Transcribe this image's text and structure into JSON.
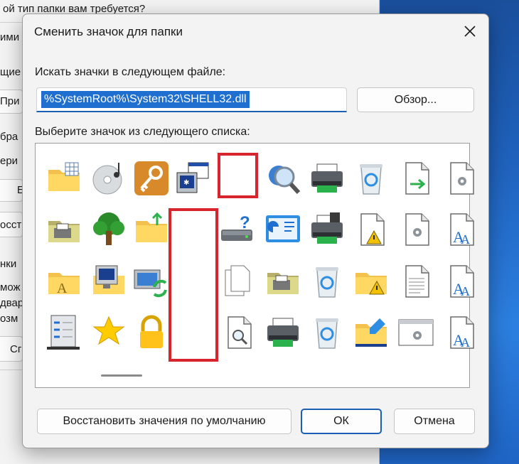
{
  "background_window": {
    "fragments": [
      "ой тип папки вам требуется?",
      "ими",
      "щие",
      "При",
      "бра",
      "ери",
      "Е",
      "осст",
      "нки",
      "мож",
      "двар",
      "озм",
      "Сг"
    ]
  },
  "dialog": {
    "title": "Сменить значок для папки",
    "close_glyph": "✕",
    "file_label": "Искать значки в следующем файле:",
    "file_value": "%SystemRoot%\\System32\\SHELL32.dll",
    "browse_label": "Обзор...",
    "list_label": "Выберите значок из следующего списка:",
    "icons": [
      [
        "folder-grid-icon",
        "cd-music-icon",
        "key-icon",
        "computer-window-icon",
        "blank",
        "magnifier-globe-icon",
        "printer-icon",
        "recycle-bin-icon",
        "file-arrow-icon",
        "gear-file-icon"
      ],
      [
        "printer-folder-icon",
        "tree-icon",
        "folder-up-icon",
        "blank",
        "drive-question-icon",
        "control-panel-icon",
        "printer-fax-icon",
        "file-warning-icon",
        "gear-file-icon",
        "font-file-icon"
      ],
      [
        "font-folder-icon",
        "computer-folder-icon",
        "monitor-sync-icon",
        "blank",
        "copy-files-icon",
        "printer-folder-icon",
        "recycle-bin-full-icon",
        "folder-warning-icon",
        "text-file-icon",
        "font-file-icon"
      ],
      [
        "server-icon",
        "star-icon",
        "lock-icon",
        "blank",
        "file-search-icon",
        "printer-icon",
        "recycle-bin-empty-icon",
        "folder-edit-icon",
        "settings-window-icon",
        "font-file-icon"
      ]
    ],
    "restore_label": "Восстановить значения по умолчанию",
    "ok_label": "ОК",
    "cancel_label": "Отмена"
  },
  "colors": {
    "accent": "#1a5fb4",
    "highlight_red": "#d8242c",
    "selection": "#1f6fd1"
  }
}
